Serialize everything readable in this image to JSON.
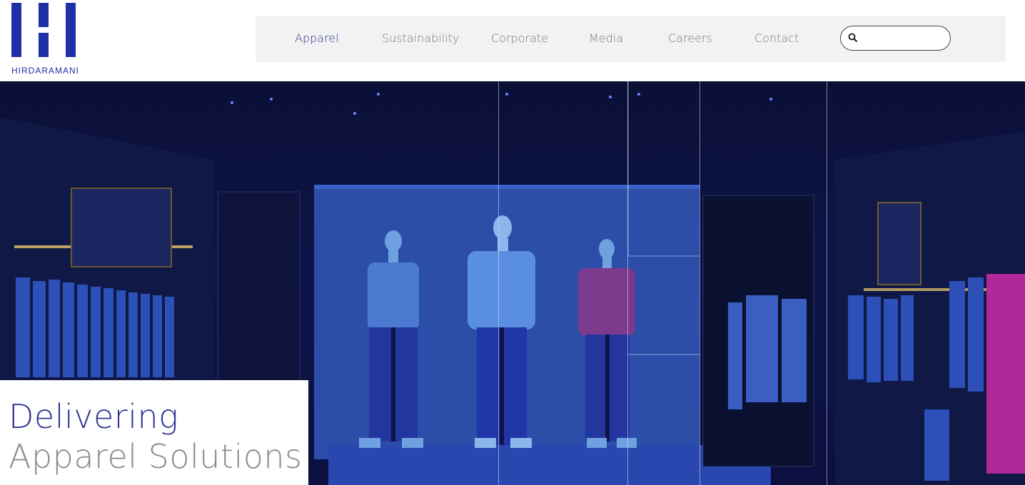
{
  "brand": {
    "name": "HIRDARAMANI",
    "color": "#1f2fa6"
  },
  "nav": {
    "items": [
      {
        "label": "Apparel",
        "active": true
      },
      {
        "label": "Sustainability",
        "active": false
      },
      {
        "label": "Corporate",
        "active": false
      },
      {
        "label": "Media",
        "active": false
      },
      {
        "label": "Careers",
        "active": false
      },
      {
        "label": "Contact",
        "active": false
      }
    ],
    "active_color": "#2a3396",
    "inactive_color": "#777777"
  },
  "search": {
    "placeholder": "",
    "value": "",
    "icon": "search-icon"
  },
  "hero": {
    "image_alt": "Apparel store interior with three mannequins in blue lighting",
    "headline": "Delivering",
    "subheadline": "Apparel Solutions",
    "headline_color": "#2f3591",
    "subheadline_color": "#8a8a8a"
  }
}
